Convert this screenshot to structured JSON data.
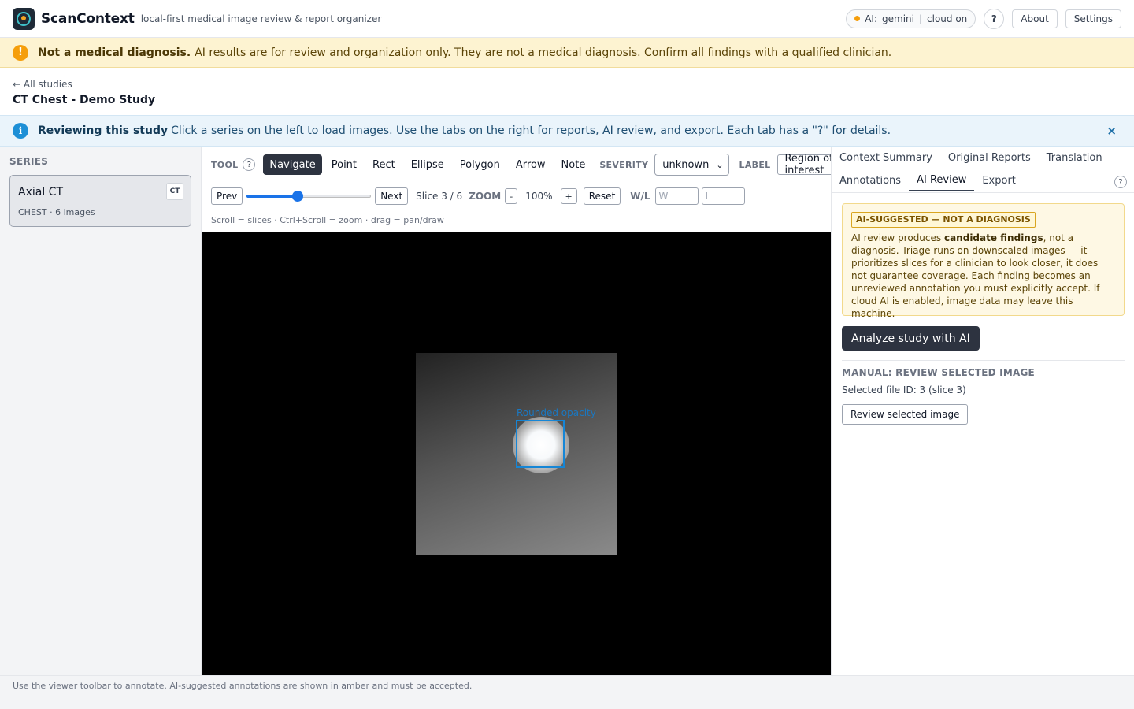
{
  "app": {
    "name": "ScanContext",
    "tagline": "local-first medical image review & report organizer",
    "ai_status": {
      "prefix": "AI:",
      "provider": "gemini",
      "separator": "|",
      "cloud": "cloud on",
      "dot_color": "#f59e0b"
    },
    "help_label": "?",
    "about_label": "About",
    "settings_label": "Settings"
  },
  "warning": {
    "icon": "!",
    "title": "Not a medical diagnosis.",
    "text": "AI results are for review and organization only. They are not a medical diagnosis. Confirm all findings with a qualified clinician."
  },
  "breadcrumb": {
    "back": "← All studies"
  },
  "study": {
    "title": "CT Chest - Demo Study"
  },
  "info": {
    "icon": "i",
    "title": "Reviewing this study",
    "text": "Click a series on the left to load images. Use the tabs on the right for reports, AI review, and export. Each tab has a \"?\" for details.",
    "close": "×"
  },
  "sidebar": {
    "title": "SERIES",
    "series": [
      {
        "name": "Axial CT",
        "meta": "CHEST · 6 images",
        "badge": "CT"
      }
    ]
  },
  "viewer": {
    "tool_label": "TOOL",
    "tool_help": "?",
    "tools": [
      "Navigate",
      "Point",
      "Rect",
      "Ellipse",
      "Polygon",
      "Arrow",
      "Note"
    ],
    "active_tool": "Navigate",
    "severity_label": "SEVERITY",
    "severity_value": "unknown",
    "label_label": "LABEL",
    "label_value": "Region of interest",
    "prev": "Prev",
    "next": "Next",
    "slice_text": "Slice 3 / 6",
    "slice_current": 3,
    "slice_total": 6,
    "zoom_label": "ZOOM",
    "zoom_minus": "-",
    "zoom_value": "100%",
    "zoom_plus": "+",
    "reset": "Reset",
    "wl_label": "W/L",
    "w_placeholder": "W",
    "l_placeholder": "L",
    "hint": "Scroll = slices · Ctrl+Scroll = zoom · drag = pan/draw",
    "annotation_label": "Rounded opacity",
    "annotation_color": "#1686d6"
  },
  "rpanel": {
    "tabs_row1": [
      "Context Summary",
      "Original Reports",
      "Translation"
    ],
    "tabs_row2": [
      "Annotations",
      "AI Review",
      "Export"
    ],
    "active_tab": "AI Review",
    "help": "?",
    "ai_badge": "AI-SUGGESTED — NOT A DIAGNOSIS",
    "ai_text_pre": "AI review produces ",
    "ai_text_bold": "candidate findings",
    "ai_text_post": ", not a diagnosis. Triage runs on downscaled images — it prioritizes slices for a clinician to look closer, it does not guarantee coverage. Each finding becomes an unreviewed annotation you must explicitly accept. If cloud AI is enabled, image data may leave this machine.",
    "analyze_btn": "Analyze study with AI",
    "manual_title": "MANUAL: REVIEW SELECTED IMAGE",
    "selected_id": "Selected file ID: 3 (slice 3)",
    "review_btn": "Review selected image"
  },
  "footer": {
    "text": "Use the viewer toolbar to annotate. AI-suggested annotations are shown in amber and must be accepted."
  }
}
